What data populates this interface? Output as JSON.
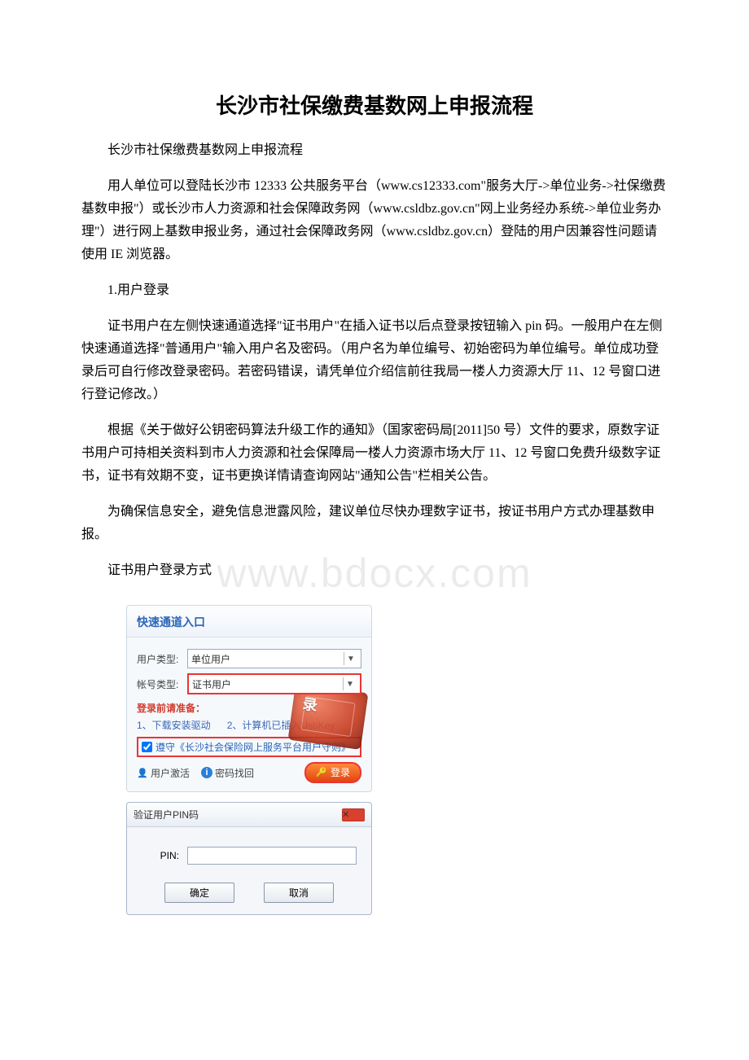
{
  "title": "长沙市社保缴费基数网上申报流程",
  "paragraphs": {
    "p1": "长沙市社保缴费基数网上申报流程",
    "p2": "用人单位可以登陆长沙市 12333 公共服务平台（www.cs12333.com\"服务大厅->单位业务->社保缴费基数申报\"）或长沙市人力资源和社会保障政务网（www.csldbz.gov.cn\"网上业务经办系统->单位业务办理\"）进行网上基数申报业务，通过社会保障政务网（www.csldbz.gov.cn）登陆的用户因兼容性问题请使用 IE 浏览器。",
    "p3": "1.用户登录",
    "p4": "证书用户在左侧快速通道选择\"证书用户\"在插入证书以后点登录按钮输入 pin 码。一般用户在左侧快速通道选择\"普通用户\"输入用户名及密码。（用户名为单位编号、初始密码为单位编号。单位成功登录后可自行修改登录密码。若密码错误，请凭单位介绍信前往我局一楼人力资源大厅 11、12 号窗口进行登记修改。）",
    "p5": "根据《关于做好公钥密码算法升级工作的通知》（国家密码局[2011]50 号）文件的要求，原数字证书用户可持相关资料到市人力资源和社会保障局一楼人力资源市场大厅 11、12 号窗口免费升级数字证书，证书有效期不变，证书更换详情请查询网站\"通知公告\"栏相关公告。",
    "p6": "为确保信息安全，避免信息泄露风险，建议单位尽快办理数字证书，按证书用户方式办理基数申报。",
    "p7": "证书用户登录方式"
  },
  "watermark": "www.bdocx.com",
  "login": {
    "header": "快速通道入口",
    "userTypeLabel": "用户类型:",
    "userTypeValue": "单位用户",
    "acctTypeLabel": "帐号类型:",
    "acctTypeValue": "证书用户",
    "prepLabel": "登录前请准备：",
    "prep1": "1、下载安装驱动",
    "prep2": "2、计算机已插入UsbKey",
    "rulesText": "遵守《长沙社会保险网上服务平台用户守则》",
    "activate": "用户激活",
    "pwdback": "密码找回",
    "loginBtn": "登录",
    "stampText": "录"
  },
  "pin": {
    "title": "验证用户PIN码",
    "label": "PIN:",
    "ok": "确定",
    "cancel": "取消"
  }
}
